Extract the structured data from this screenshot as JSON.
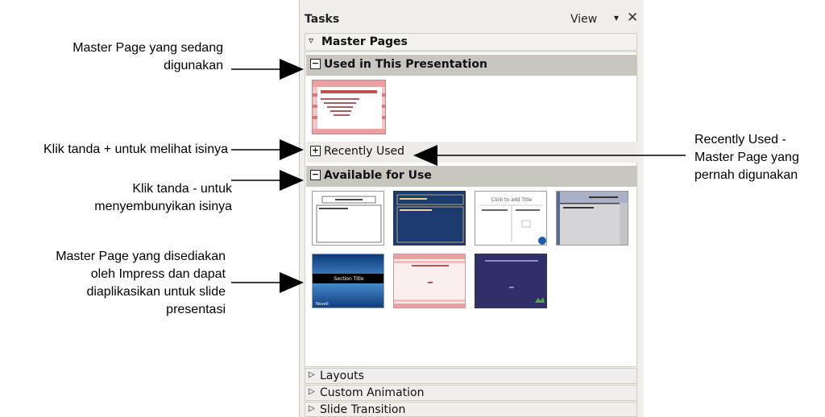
{
  "pane": {
    "title": "Tasks",
    "view_label": "View",
    "dropdown_glyph": "▾",
    "close_glyph": "✕",
    "master_pages_label": "Master Pages",
    "used_label": "Used in This Presentation",
    "recent_label": "Recently Used",
    "available_label": "Available for Use",
    "collapse_glyph": "−",
    "expand_glyph": "+",
    "layouts_label": "Layouts",
    "custom_animation_label": "Custom Animation",
    "slide_transition_label": "Slide Transition"
  },
  "thumbs": {
    "t2_title": "Click to add Title",
    "t5_title": "Section Title",
    "t5_brand": "Novell"
  },
  "annotations": {
    "used_note_line1": "Master Page yang sedang",
    "used_note_line2": "digunakan",
    "expand_note": "Klik tanda + untuk melihat isinya",
    "collapse_note_line1": "Klik tanda - untuk",
    "collapse_note_line2": "menyembunyikan  isinya",
    "available_note_line1": "Master Page yang disediakan",
    "available_note_line2": "oleh Impress dan dapat",
    "available_note_line3": "diaplikasikan untuk slide",
    "available_note_line4": "presentasi",
    "recent_note_line1": "Recently Used -",
    "recent_note_line2": "Master Page yang",
    "recent_note_line3": "pernah digunakan"
  },
  "colors": {
    "pane_bg": "#efeeea",
    "header_dark": "#c9c6c0",
    "navy": "#1d3a6e",
    "pink": "#e8a0a0"
  }
}
